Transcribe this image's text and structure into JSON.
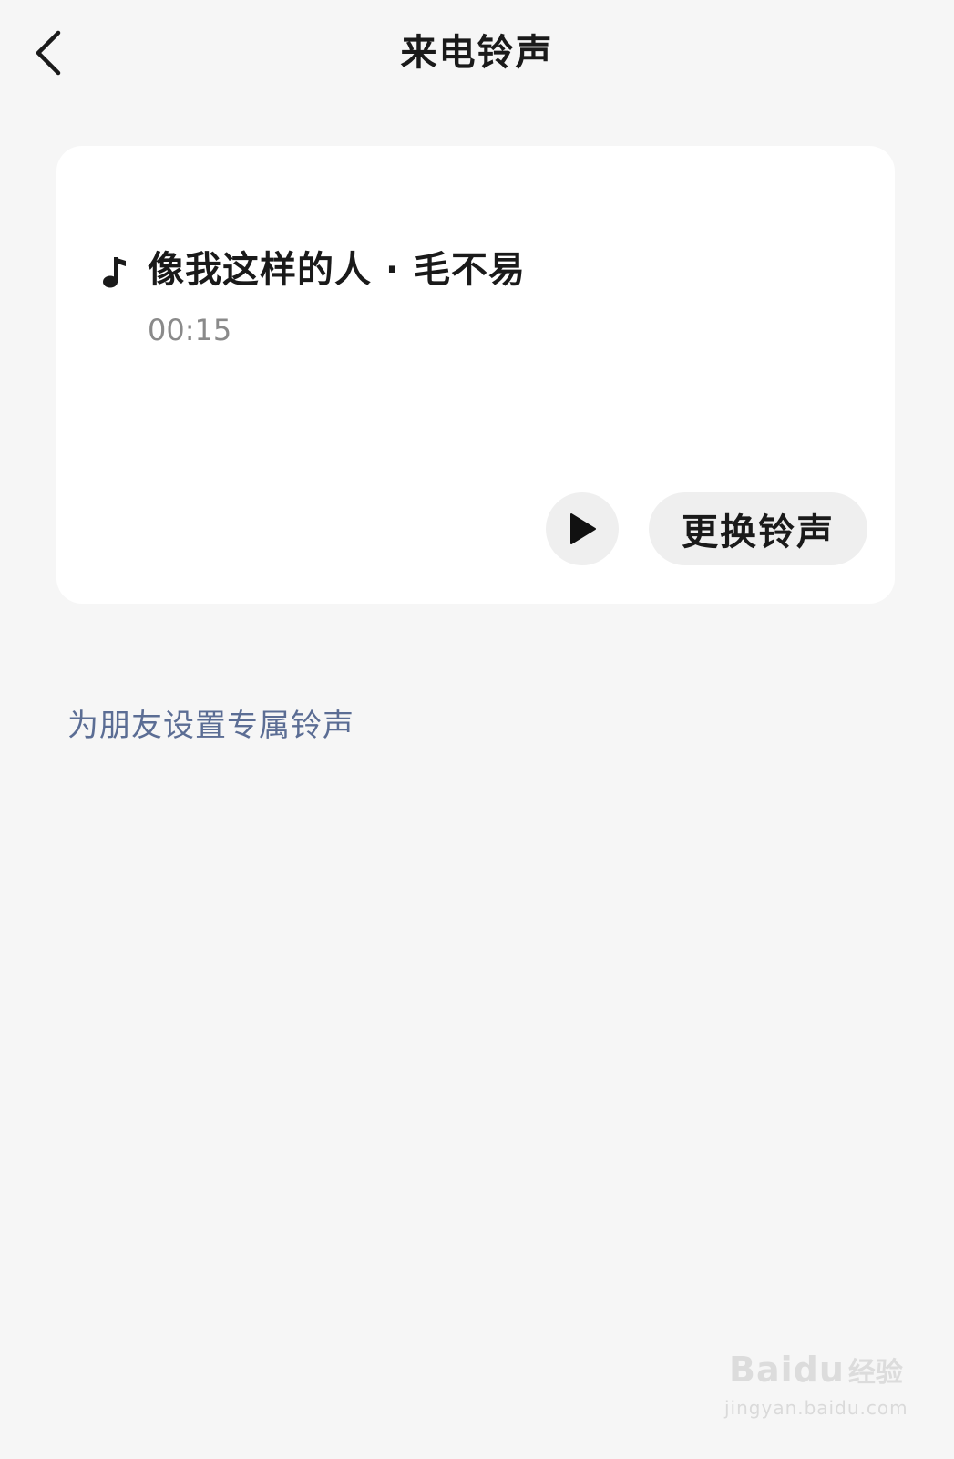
{
  "header": {
    "title": "来电铃声",
    "back_icon": "chevron-left-icon"
  },
  "ringtone_card": {
    "icon": "music-note-icon",
    "song_title": "像我这样的人 · 毛不易",
    "duration": "00:15",
    "play_icon": "play-icon",
    "change_label": "更换铃声"
  },
  "friend_link": {
    "label": "为朋友设置专属铃声",
    "color": "#5b6d94"
  },
  "watermark": {
    "brand": "Baidu",
    "label": "经验",
    "url": "jingyan.baidu.com"
  },
  "colors": {
    "background": "#f6f6f6",
    "card": "#ffffff",
    "button_bg": "#efefef",
    "muted_text": "#8a8a8a"
  }
}
